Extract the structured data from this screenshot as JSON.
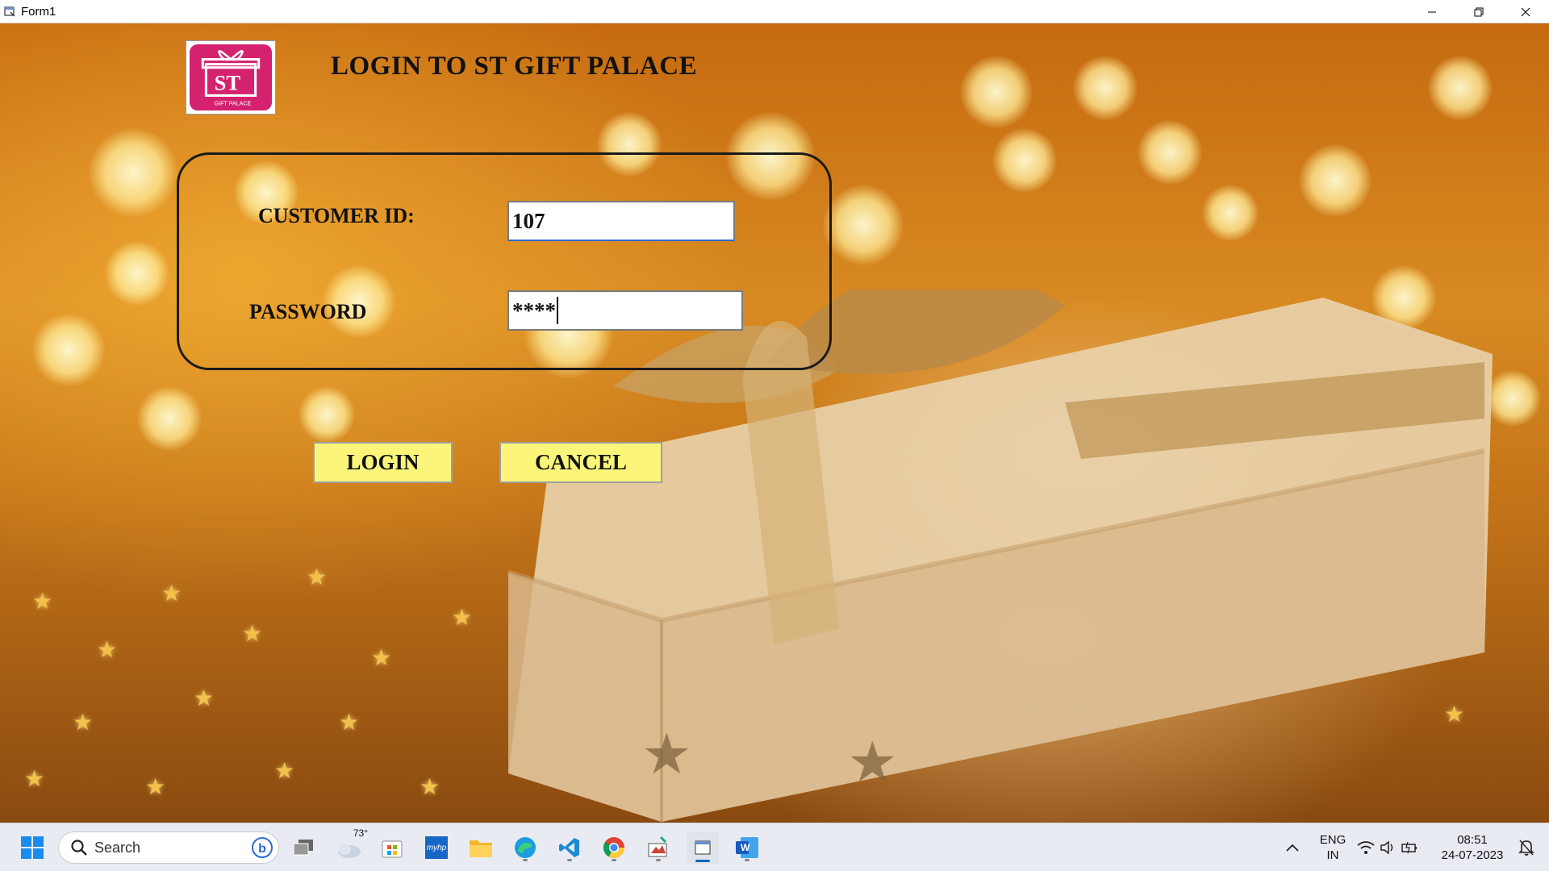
{
  "window": {
    "title": "Form1",
    "minimize_icon": "minimize-icon",
    "maximize_icon": "restore-icon",
    "close_icon": "close-icon"
  },
  "form": {
    "heading": "LOGIN TO ST GIFT PALACE",
    "logo": {
      "name": "st-gift-palace-logo",
      "text": "ST",
      "subtext": "GIFT PALACE",
      "color": "#d4226e"
    },
    "customer_id": {
      "label": "CUSTOMER ID:",
      "value": "107"
    },
    "password": {
      "label": "PASSWORD",
      "value": "****"
    },
    "buttons": {
      "login": "LOGIN",
      "cancel": "CANCEL"
    },
    "colors": {
      "button_bg": "#fbf67a",
      "accent": "#2a6bd8"
    }
  },
  "taskbar": {
    "search_label": "Search",
    "weather_temp": "73°",
    "apps": [
      "start-icon",
      "task-view-icon",
      "weather-icon",
      "store-icon",
      "myhp-icon",
      "file-explorer-icon",
      "edge-icon",
      "vscode-icon",
      "chrome-icon",
      "paint-icon",
      "form-app-icon",
      "word-icon"
    ],
    "myhp_label": "myhp",
    "word_label": "W",
    "tray": {
      "lang_top": "ENG",
      "lang_bottom": "IN",
      "time": "08:51",
      "date": "24-07-2023"
    }
  }
}
